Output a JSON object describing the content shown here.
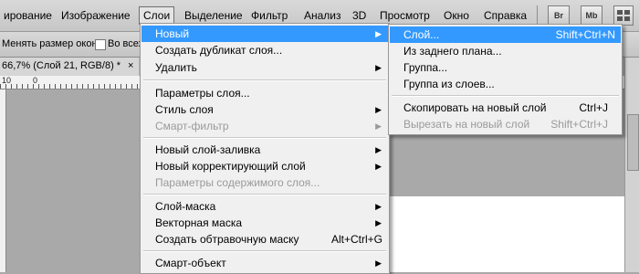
{
  "menubar": {
    "items": [
      "ирование",
      "Изображение",
      "Слои",
      "Выделение",
      "Фильтр",
      "Анализ",
      "3D",
      "Просмотр",
      "Окно",
      "Справка"
    ],
    "btn_bridge": "Br",
    "btn_mini": "Mb"
  },
  "options": {
    "resize_label": "Менять размер окон",
    "all_label": "Во всех"
  },
  "document": {
    "tab_title": "66,7% (Слой 21, RGB/8) *",
    "tab_close": "×"
  },
  "ruler": {
    "numbers": [
      "10",
      "0",
      "5"
    ]
  },
  "layer_menu": {
    "items": [
      {
        "label": "Новый",
        "arrow": "▶"
      },
      {
        "label": "Создать дубликат слоя..."
      },
      {
        "label": "Удалить",
        "arrow": "▶"
      },
      {
        "label": "Параметры слоя..."
      },
      {
        "label": "Стиль слоя",
        "arrow": "▶"
      },
      {
        "label": "Смарт-фильтр",
        "arrow": "▶"
      },
      {
        "label": "Новый слой-заливка",
        "arrow": "▶"
      },
      {
        "label": "Новый корректирующий слой",
        "arrow": "▶"
      },
      {
        "label": "Параметры содержимого слоя..."
      },
      {
        "label": "Слой-маска",
        "arrow": "▶"
      },
      {
        "label": "Векторная маска",
        "arrow": "▶"
      },
      {
        "label": "Создать обтравочную маску",
        "shortcut": "Alt+Ctrl+G"
      },
      {
        "label": "Смарт-объект",
        "arrow": "▶"
      }
    ]
  },
  "new_submenu": {
    "items": [
      {
        "label": "Слой...",
        "shortcut": "Shift+Ctrl+N"
      },
      {
        "label": "Из заднего плана..."
      },
      {
        "label": "Группа..."
      },
      {
        "label": "Группа из слоев..."
      },
      {
        "label": "Скопировать на новый слой",
        "shortcut": "Ctrl+J"
      },
      {
        "label": "Вырезать на новый слой",
        "shortcut": "Shift+Ctrl+J"
      }
    ]
  },
  "colors": {
    "highlight": "#3399ff",
    "menu_bg": "#f0f0f0",
    "workspace": "#a9a9a9"
  }
}
